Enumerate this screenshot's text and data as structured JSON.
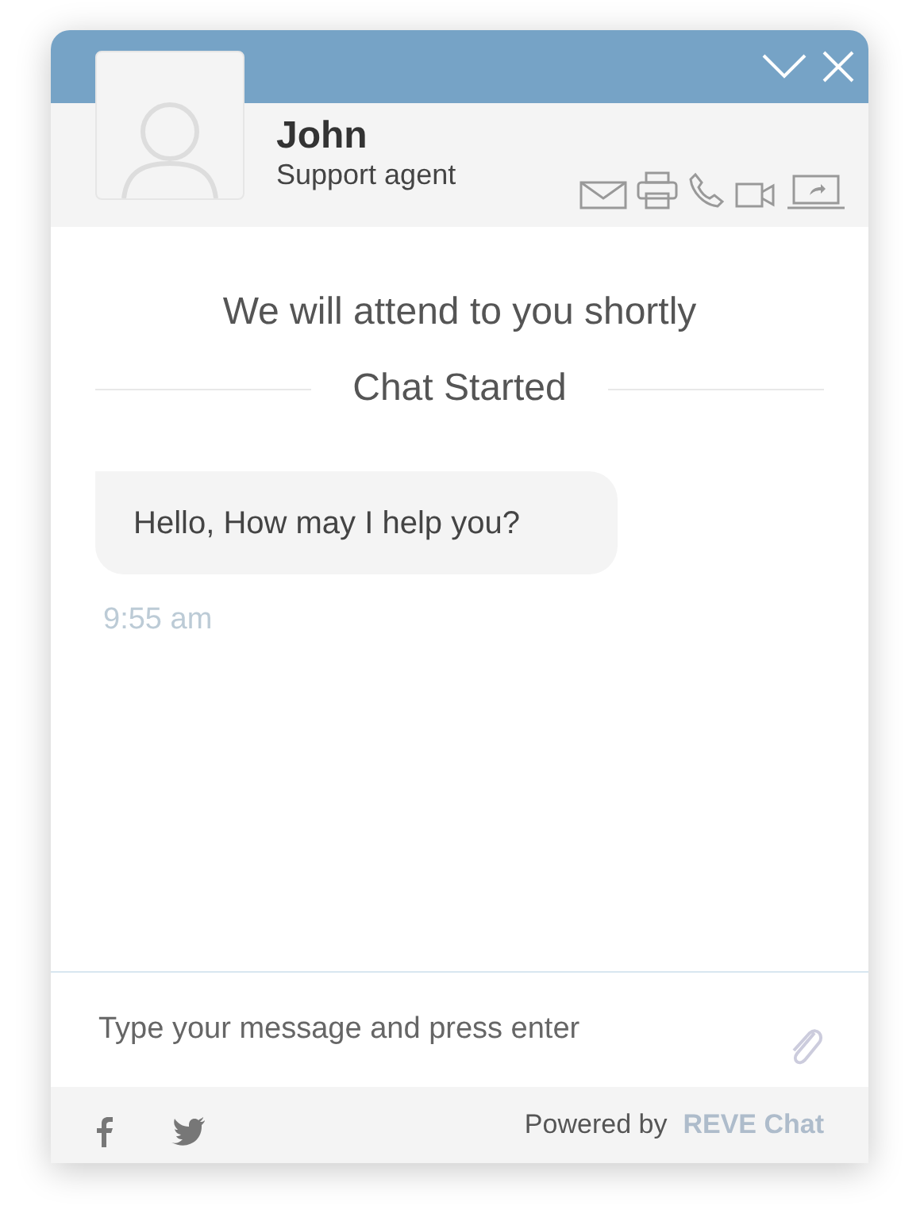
{
  "agent": {
    "name": "John",
    "role": "Support agent"
  },
  "notice": "We will attend to you shortly",
  "separator": "Chat Started",
  "messages": [
    {
      "text": "Hello, How may I help you?",
      "time": "9:55 am"
    }
  ],
  "composer": {
    "placeholder": "Type your message and press enter"
  },
  "footer": {
    "powered_by": "Powered by",
    "brand": "REVE Chat"
  }
}
